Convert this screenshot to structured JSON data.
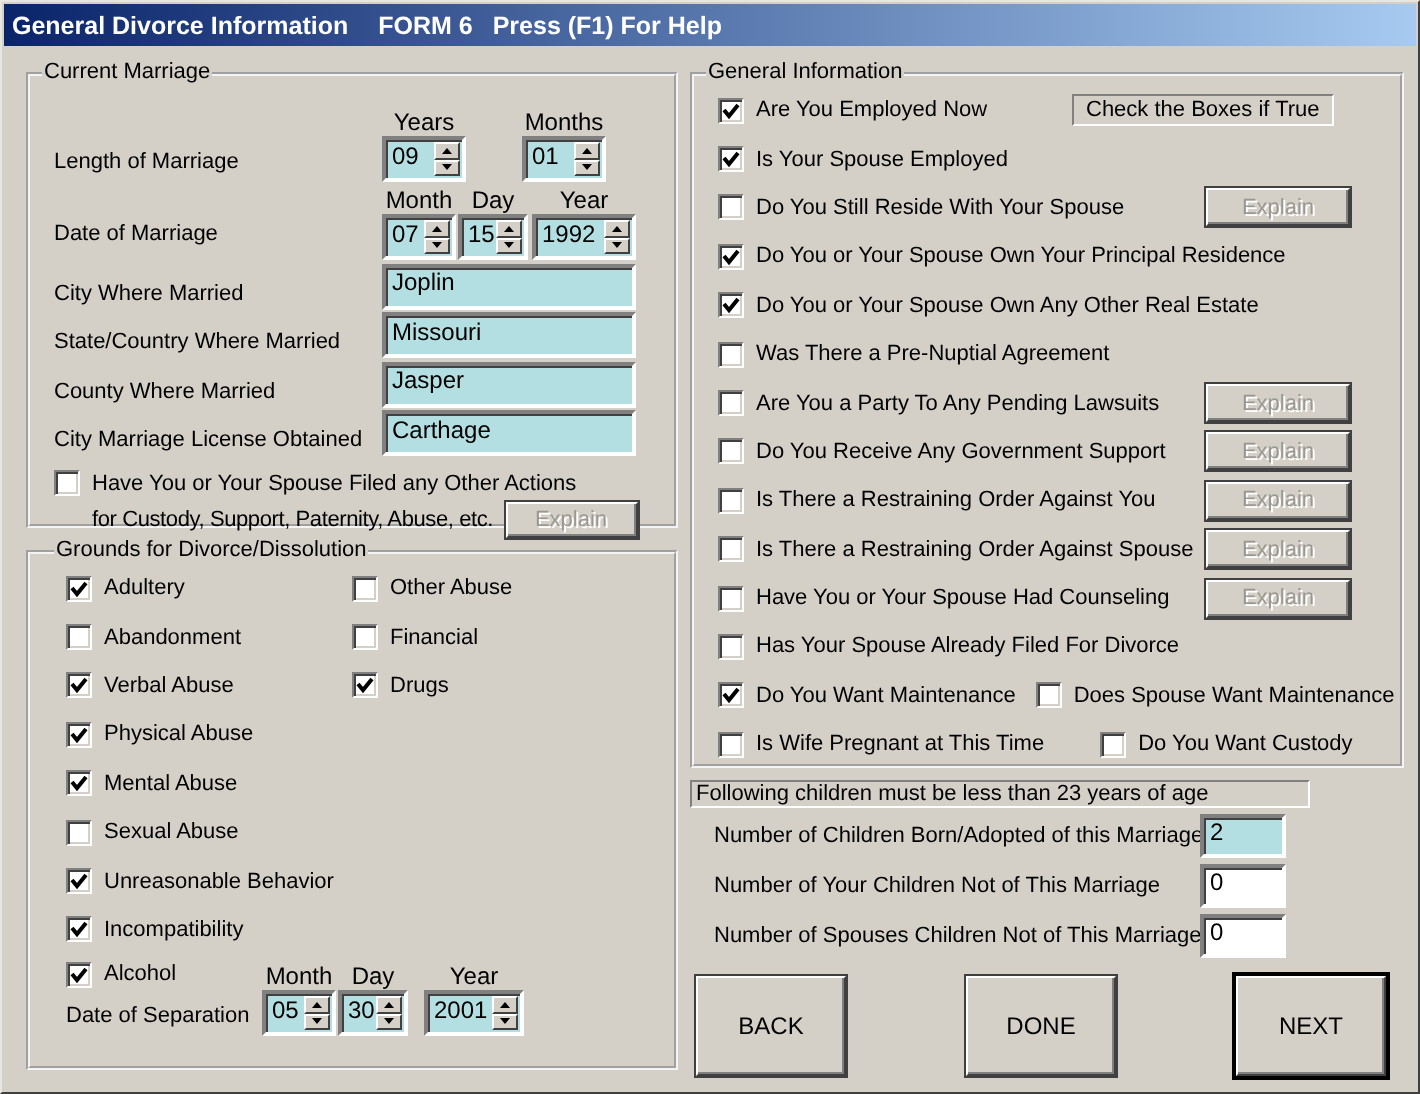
{
  "title_bar": {
    "title": "General Divorce Information",
    "form": "FORM 6",
    "help": "Press (F1) For Help"
  },
  "current_marriage": {
    "legend": "Current Marriage",
    "length": {
      "label": "Length of Marriage",
      "parts": [
        {
          "header": "Years",
          "value": "09"
        },
        {
          "header": "Months",
          "value": "01"
        }
      ]
    },
    "date": {
      "label": "Date of Marriage",
      "parts": [
        {
          "header": "Month",
          "value": "07"
        },
        {
          "header": "Day",
          "value": "15"
        },
        {
          "header": "Year",
          "value": "1992"
        }
      ]
    },
    "fields": [
      {
        "label": "City Where Married",
        "value": "Joplin"
      },
      {
        "label": "State/Country Where Married",
        "value": "Missouri"
      },
      {
        "label": "County Where Married",
        "value": "Jasper"
      },
      {
        "label": "City Marriage License Obtained",
        "value": "Carthage"
      }
    ],
    "other_actions": {
      "checked": false,
      "lines": [
        "Have You or Your Spouse Filed any Other Actions",
        "for Custody, Support, Paternity, Abuse, etc."
      ],
      "button": {
        "label": "Explain",
        "disabled": true
      }
    }
  },
  "grounds": {
    "legend": "Grounds for Divorce/Dissolution",
    "columns": [
      [
        {
          "label": "Adultery",
          "checked": true
        },
        {
          "label": "Abandonment",
          "checked": false
        },
        {
          "label": "Verbal Abuse",
          "checked": true
        },
        {
          "label": "Physical Abuse",
          "checked": true
        },
        {
          "label": "Mental Abuse",
          "checked": true
        },
        {
          "label": "Sexual Abuse",
          "checked": false
        },
        {
          "label": "Unreasonable Behavior",
          "checked": true
        },
        {
          "label": "Incompatibility",
          "checked": true
        },
        {
          "label": "Alcohol",
          "checked": true
        }
      ],
      [
        {
          "label": "Other Abuse",
          "checked": false
        },
        {
          "label": "Financial",
          "checked": false
        },
        {
          "label": "Drugs",
          "checked": true
        }
      ]
    ],
    "separation": {
      "label": "Date of Separation",
      "parts": [
        {
          "header": "Month",
          "value": "05"
        },
        {
          "header": "Day",
          "value": "30"
        },
        {
          "header": "Year",
          "value": "2001"
        }
      ]
    }
  },
  "general_info": {
    "legend": "General Information",
    "rows": [
      {
        "checks": [
          {
            "label": "Are You Employed Now",
            "checked": true
          }
        ],
        "side": {
          "kind": "note",
          "text": "Check the Boxes if True"
        }
      },
      {
        "checks": [
          {
            "label": "Is Your Spouse Employed",
            "checked": true
          }
        ]
      },
      {
        "checks": [
          {
            "label": "Do You Still Reside With Your Spouse",
            "checked": false
          }
        ],
        "side": {
          "kind": "button",
          "label": "Explain",
          "disabled": true
        }
      },
      {
        "checks": [
          {
            "label": "Do You or Your Spouse Own Your Principal Residence",
            "checked": true
          }
        ]
      },
      {
        "checks": [
          {
            "label": "Do You or Your Spouse Own Any Other Real Estate",
            "checked": true
          }
        ]
      },
      {
        "checks": [
          {
            "label": "Was There a Pre-Nuptial Agreement",
            "checked": false
          }
        ]
      },
      {
        "checks": [
          {
            "label": "Are You a Party To Any Pending Lawsuits",
            "checked": false
          }
        ],
        "side": {
          "kind": "button",
          "label": "Explain",
          "disabled": true
        }
      },
      {
        "checks": [
          {
            "label": "Do You Receive Any Government Support",
            "checked": false
          }
        ],
        "side": {
          "kind": "button",
          "label": "Explain",
          "disabled": true
        }
      },
      {
        "checks": [
          {
            "label": "Is There a Restraining Order Against You",
            "checked": false
          }
        ],
        "side": {
          "kind": "button",
          "label": "Explain",
          "disabled": true
        }
      },
      {
        "checks": [
          {
            "label": "Is There a Restraining Order Against Spouse",
            "checked": false
          }
        ],
        "side": {
          "kind": "button",
          "label": "Explain",
          "disabled": true
        }
      },
      {
        "checks": [
          {
            "label": "Have You or Your Spouse Had Counseling",
            "checked": false
          }
        ],
        "side": {
          "kind": "button",
          "label": "Explain",
          "disabled": true
        }
      },
      {
        "checks": [
          {
            "label": "Has Your Spouse Already Filed For Divorce",
            "checked": false
          }
        ]
      },
      {
        "checks": [
          {
            "label": "Do You Want Maintenance",
            "checked": true
          },
          {
            "label": "Does Spouse Want Maintenance",
            "checked": false
          }
        ]
      },
      {
        "checks": [
          {
            "label": "Is Wife Pregnant at This Time",
            "checked": false
          },
          {
            "label": "Do You Want Custody",
            "checked": false
          }
        ]
      }
    ]
  },
  "children": {
    "note": "Following children must be less than 23 years of age",
    "fields": [
      {
        "label": "Number of Children Born/Adopted of this Marriage",
        "value": "2",
        "focused": true
      },
      {
        "label": "Number of Your Children Not of This Marriage",
        "value": "0",
        "focused": false
      },
      {
        "label": "Number of Spouses Children Not of This Marriage",
        "value": "0",
        "focused": false
      }
    ]
  },
  "buttons": [
    {
      "label": "BACK",
      "default": false
    },
    {
      "label": "DONE",
      "default": false
    },
    {
      "label": "NEXT",
      "default": true
    }
  ]
}
